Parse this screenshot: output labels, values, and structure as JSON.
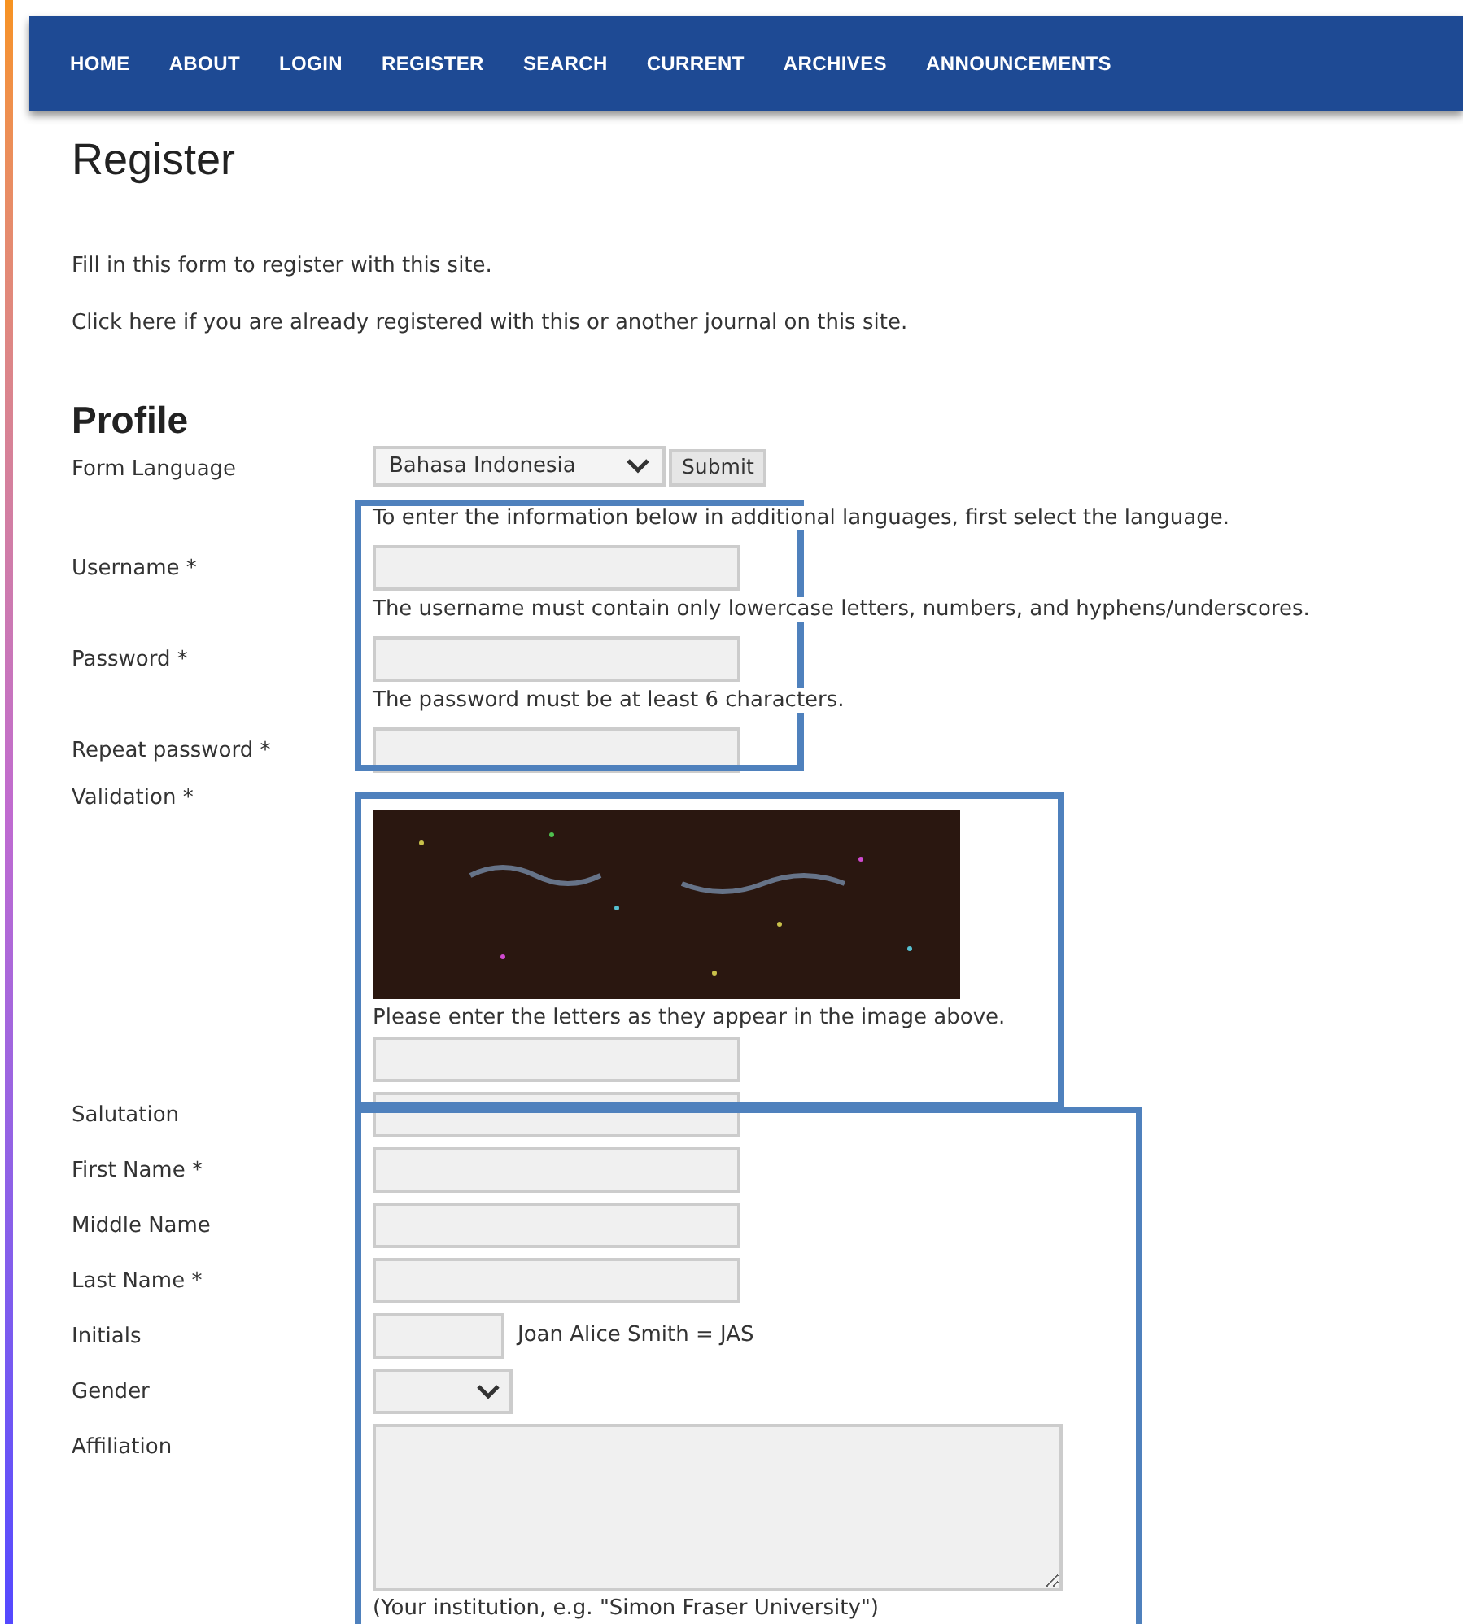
{
  "nav": [
    {
      "label": "HOME"
    },
    {
      "label": "ABOUT"
    },
    {
      "label": "LOGIN"
    },
    {
      "label": "REGISTER"
    },
    {
      "label": "SEARCH"
    },
    {
      "label": "CURRENT"
    },
    {
      "label": "ARCHIVES"
    },
    {
      "label": "ANNOUNCEMENTS"
    }
  ],
  "title": "Register",
  "intro": [
    "Fill in this form to register with this site.",
    "Click here if you are already registered with this or another journal on this site."
  ],
  "section": "Profile",
  "fields": [
    {
      "kind": "select",
      "label": "Form Language",
      "value": "Bahasa Indonesia",
      "button": "Submit",
      "hint": "To enter the information below in additional languages, first select the language."
    },
    {
      "kind": "text",
      "label": "Username *",
      "hint": "The username must contain only lowercase letters, numbers, and hyphens/underscores."
    },
    {
      "kind": "text",
      "label": "Password *",
      "hint": "The password must be at least 6 characters."
    },
    {
      "kind": "text",
      "label": "Repeat password *"
    },
    {
      "kind": "captcha",
      "label": "Validation *",
      "hint": "Please enter the letters as they appear in the image above."
    },
    {
      "kind": "text",
      "label": "Salutation"
    },
    {
      "kind": "text",
      "label": "First Name *"
    },
    {
      "kind": "text",
      "label": "Middle Name"
    },
    {
      "kind": "text",
      "label": "Last Name *"
    },
    {
      "kind": "short",
      "label": "Initials",
      "note": "Joan Alice Smith = JAS"
    },
    {
      "kind": "dropdown",
      "label": "Gender"
    },
    {
      "kind": "textarea",
      "label": "Affiliation",
      "hint": "(Your institution, e.g. \"Simon Fraser University\")"
    }
  ],
  "highlight_frames": [
    {
      "color": "#4f81bd"
    },
    {
      "color": "#4f81bd"
    },
    {
      "color": "#4f81bd"
    }
  ]
}
